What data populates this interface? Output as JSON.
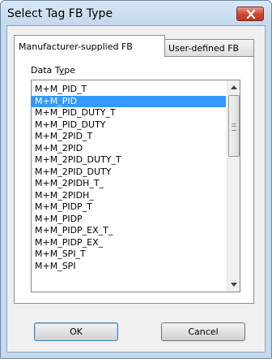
{
  "dialog": {
    "title": "Select Tag FB Type",
    "close_icon": "close-x-icon"
  },
  "tabs": [
    {
      "label": "Manufacturer-supplied FB",
      "active": true
    },
    {
      "label": "User-defined FB",
      "active": false
    }
  ],
  "list": {
    "label_prefix": "Data T",
    "label_accel": "y",
    "label_suffix": "pe",
    "items": [
      "M+M_PID_T",
      "M+M_PID",
      "M+M_PID_DUTY_T",
      "M+M_PID_DUTY",
      "M+M_2PID_T",
      "M+M_2PID",
      "M+M_2PID_DUTY_T",
      "M+M_2PID_DUTY",
      "M+M_2PIDH_T_",
      "M+M_2PIDH_",
      "M+M_PIDP_T",
      "M+M_PIDP",
      "M+M_PIDP_EX_T_",
      "M+M_PIDP_EX_",
      "M+M_SPI_T",
      "M+M_SPI"
    ],
    "selected_index": 1
  },
  "buttons": {
    "ok": "OK",
    "cancel": "Cancel"
  },
  "colors": {
    "selection": "#3399ff",
    "frame": "#c5d9ee",
    "close_button": "#c9462f"
  }
}
